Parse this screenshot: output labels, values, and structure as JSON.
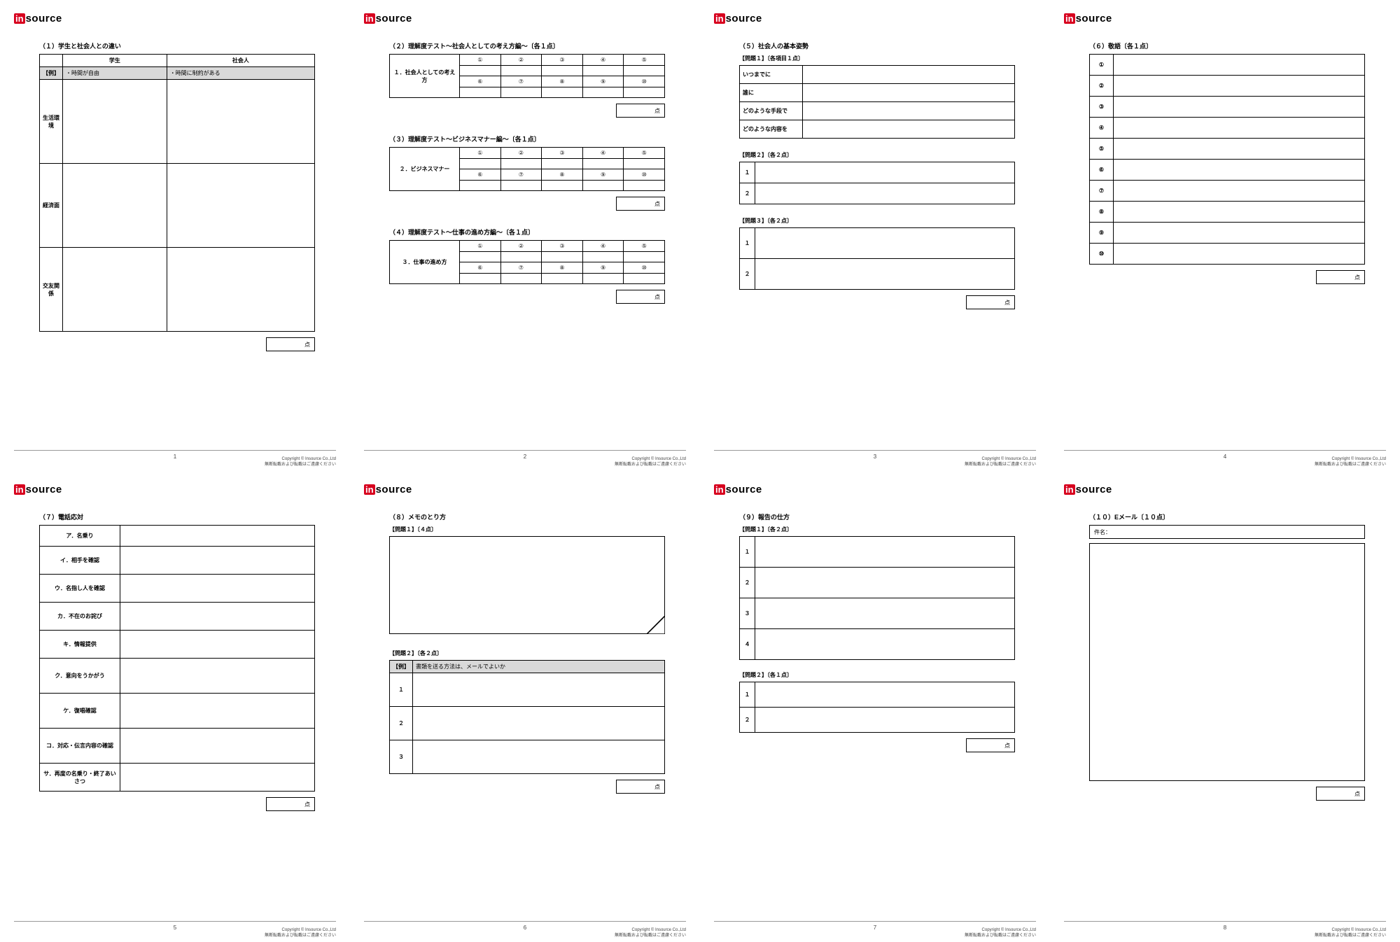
{
  "logo": {
    "in": "in",
    "source": "source"
  },
  "score_label": "点",
  "copyright": {
    "line1": "Copyright © Insource Co.,Ltd",
    "line2": "無断転載および転載はご遠慮ください"
  },
  "pages": [
    "1",
    "2",
    "3",
    "4",
    "5",
    "6",
    "7",
    "8"
  ],
  "p1": {
    "title": "（１）学生と社会人との違い",
    "col_student": "学生",
    "col_worker": "社会人",
    "ex_label": "【例】",
    "ex_student": "・時間が自由",
    "ex_worker": "・時間に制約がある",
    "rows": [
      "生活環境",
      "経済面",
      "交友関係"
    ]
  },
  "p2": {
    "s2": {
      "title": "（２）理解度テスト～社会人としての考え方編～〔各１点〕",
      "label": "１．社会人としての考え方"
    },
    "s3": {
      "title": "（３）理解度テスト～ビジネスマナー編～〔各１点〕",
      "label": "２．ビジネスマナー"
    },
    "s4": {
      "title": "（４）理解度テスト～仕事の進め方編～〔各１点〕",
      "label": "３．仕事の進め方"
    },
    "nums": [
      "①",
      "②",
      "③",
      "④",
      "⑤",
      "⑥",
      "⑦",
      "⑧",
      "⑨",
      "⑩"
    ]
  },
  "p3": {
    "title": "（５）社会人の基本姿勢",
    "q1": {
      "label": "【問題１】〔各項目１点〕",
      "rows": [
        "いつまでに",
        "誰に",
        "どのような手段で",
        "どのような内容を"
      ]
    },
    "q2": {
      "label": "【問題２】〔各２点〕",
      "rows": [
        "１",
        "２"
      ]
    },
    "q3": {
      "label": "【問題３】〔各２点〕",
      "rows": [
        "１",
        "２"
      ]
    }
  },
  "p4": {
    "title": "（６）敬語〔各１点〕",
    "rows": [
      "①",
      "②",
      "③",
      "④",
      "⑤",
      "⑥",
      "⑦",
      "⑧",
      "⑨",
      "⑩"
    ]
  },
  "p5": {
    "title": "（７）電話応対",
    "rows": [
      "ア．名乗り",
      "イ．相手を確認",
      "ウ．名指し人を確認",
      "カ．不在のお詫び",
      "キ．情報提供",
      "ク．意向をうかがう",
      "ケ．復唱確認",
      "コ．対応・伝言内容の確認",
      "サ．再度の名乗り・終了あいさつ"
    ]
  },
  "p6": {
    "title": "（８）メモのとり方",
    "q1": "【問題１】〔４点〕",
    "q2": "【問題２】〔各２点〕",
    "ex_label": "【例】",
    "ex_text": "書類を送る方法は、メールでよいか",
    "rows": [
      "１",
      "２",
      "３"
    ]
  },
  "p7": {
    "title": "（９）報告の仕方",
    "q1": {
      "label": "【問題１】〔各２点〕",
      "rows": [
        "１",
        "２",
        "３",
        "４"
      ]
    },
    "q2": {
      "label": "【問題２】〔各１点〕",
      "rows": [
        "１",
        "２"
      ]
    }
  },
  "p8": {
    "title": "（１０）Eメール〔１０点〕",
    "subject": "件名："
  }
}
